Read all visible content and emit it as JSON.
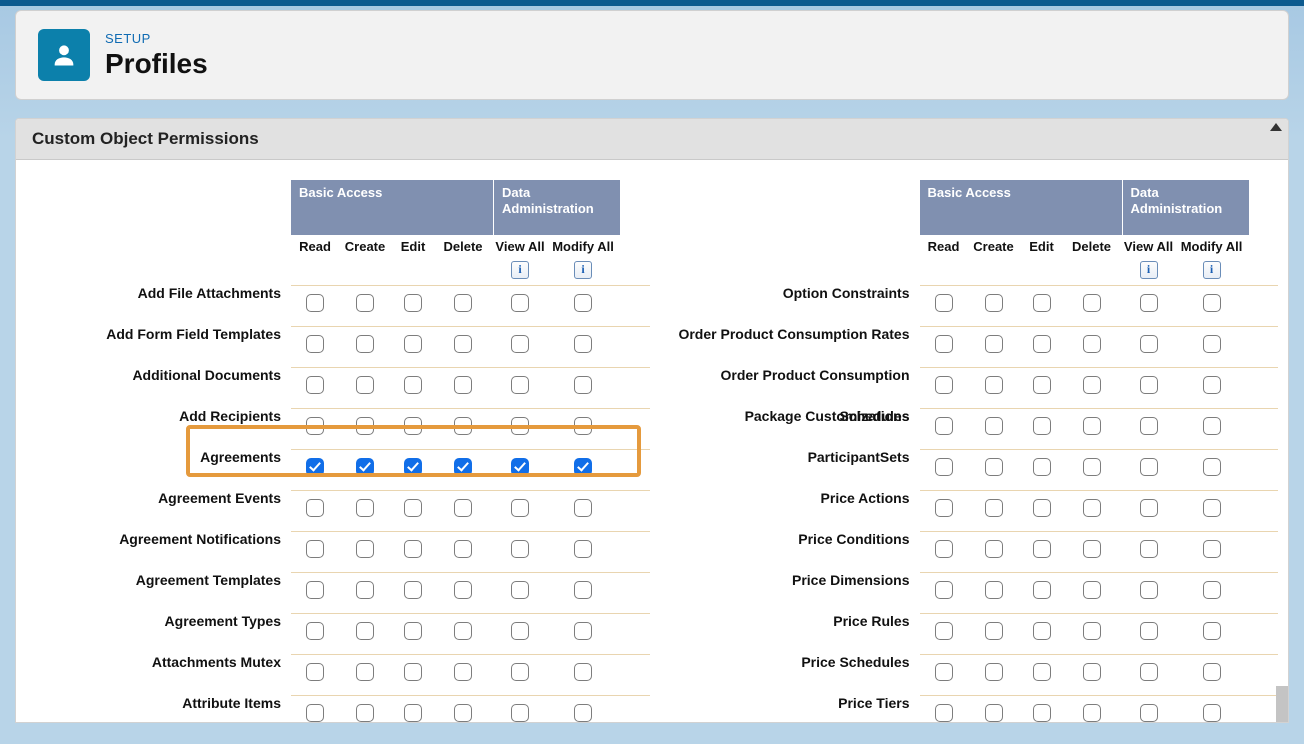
{
  "header": {
    "setup": "SETUP",
    "title": "Profiles"
  },
  "section_title": "Custom Object Permissions",
  "column_groups": {
    "basic": "Basic Access",
    "data": "Data Administration"
  },
  "columns": [
    "Read",
    "Create",
    "Edit",
    "Delete",
    "View All",
    "Modify All"
  ],
  "left_rows": [
    {
      "label": "Add File Attachments",
      "perms": [
        false,
        false,
        false,
        false,
        false,
        false
      ]
    },
    {
      "label": "Add Form Field Templates",
      "perms": [
        false,
        false,
        false,
        false,
        false,
        false
      ]
    },
    {
      "label": "Additional Documents",
      "perms": [
        false,
        false,
        false,
        false,
        false,
        false
      ]
    },
    {
      "label": "Add Recipients",
      "perms": [
        false,
        false,
        false,
        false,
        false,
        false
      ]
    },
    {
      "label": "Agreements",
      "perms": [
        true,
        true,
        true,
        true,
        true,
        true
      ],
      "highlighted": true
    },
    {
      "label": "Agreement Events",
      "perms": [
        false,
        false,
        false,
        false,
        false,
        false
      ]
    },
    {
      "label": "Agreement Notifications",
      "perms": [
        false,
        false,
        false,
        false,
        false,
        false
      ]
    },
    {
      "label": "Agreement Templates",
      "perms": [
        false,
        false,
        false,
        false,
        false,
        false
      ]
    },
    {
      "label": "Agreement Types",
      "perms": [
        false,
        false,
        false,
        false,
        false,
        false
      ]
    },
    {
      "label": "Attachments Mutex",
      "perms": [
        false,
        false,
        false,
        false,
        false,
        false
      ]
    },
    {
      "label": "Attribute Items",
      "perms": [
        false,
        false,
        false,
        false,
        false,
        false
      ]
    }
  ],
  "right_rows": [
    {
      "label": "Option Constraints",
      "perms": [
        false,
        false,
        false,
        false,
        false,
        false
      ]
    },
    {
      "label": "Order Product Consumption Rates",
      "perms": [
        false,
        false,
        false,
        false,
        false,
        false
      ]
    },
    {
      "label": "Order Product Consumption Schedules",
      "perms": [
        false,
        false,
        false,
        false,
        false,
        false
      ]
    },
    {
      "label": "Package Customizations",
      "perms": [
        false,
        false,
        false,
        false,
        false,
        false
      ]
    },
    {
      "label": "ParticipantSets",
      "perms": [
        false,
        false,
        false,
        false,
        false,
        false
      ]
    },
    {
      "label": "Price Actions",
      "perms": [
        false,
        false,
        false,
        false,
        false,
        false
      ]
    },
    {
      "label": "Price Conditions",
      "perms": [
        false,
        false,
        false,
        false,
        false,
        false
      ]
    },
    {
      "label": "Price Dimensions",
      "perms": [
        false,
        false,
        false,
        false,
        false,
        false
      ]
    },
    {
      "label": "Price Rules",
      "perms": [
        false,
        false,
        false,
        false,
        false,
        false
      ]
    },
    {
      "label": "Price Schedules",
      "perms": [
        false,
        false,
        false,
        false,
        false,
        false
      ]
    },
    {
      "label": "Price Tiers",
      "perms": [
        false,
        false,
        false,
        false,
        false,
        false
      ]
    }
  ]
}
